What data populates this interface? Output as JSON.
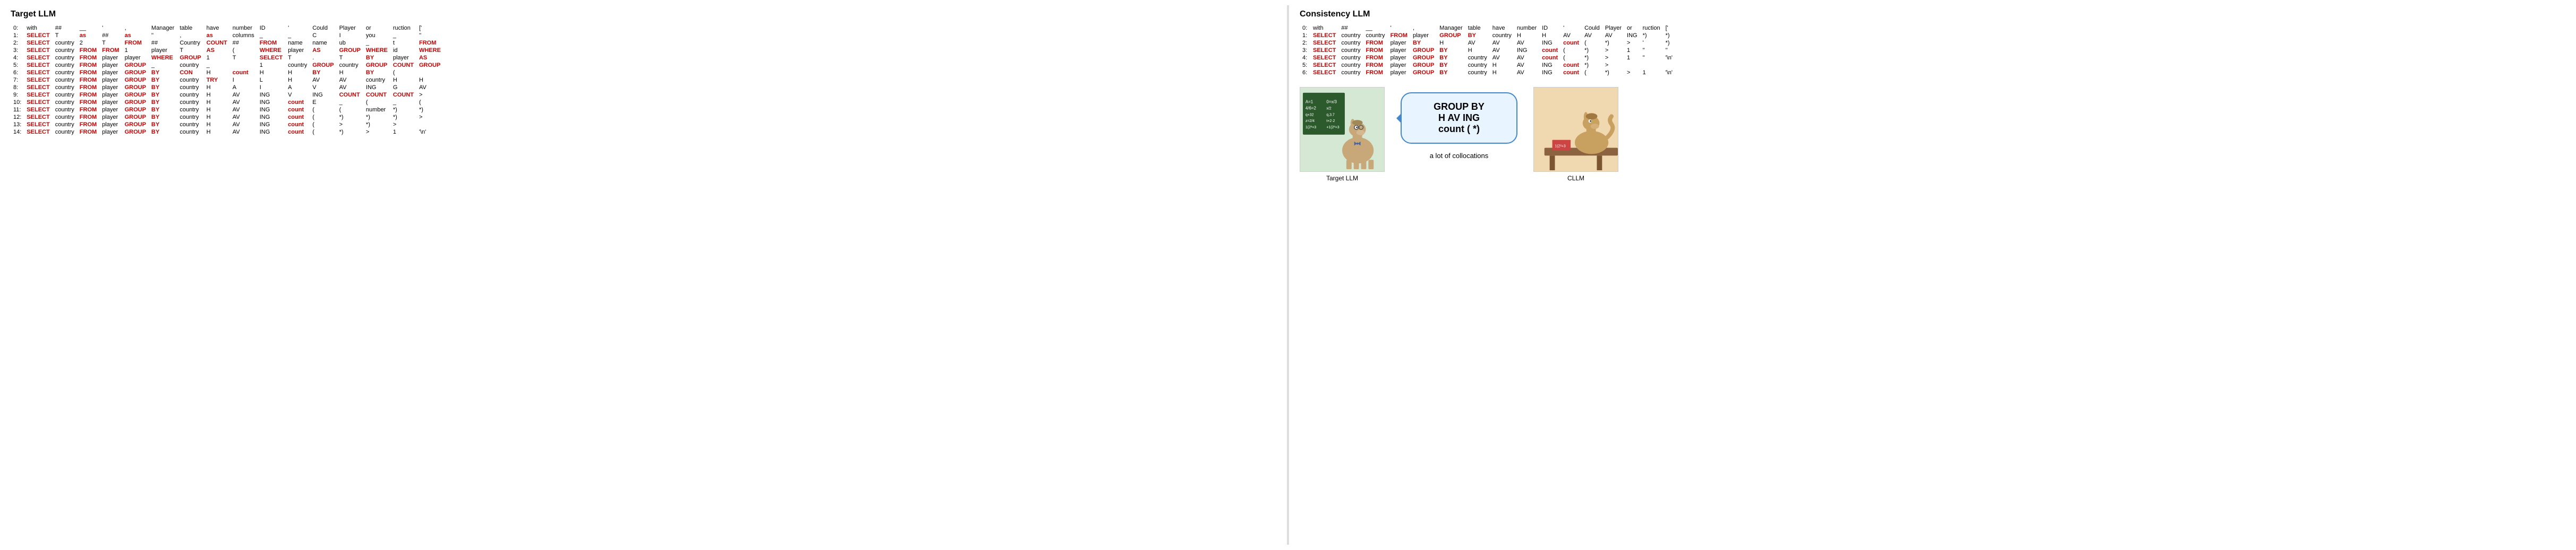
{
  "targetLLM": {
    "title": "Target LLM",
    "rows": [
      {
        "num": "0:",
        "tokens": [
          "with",
          "##",
          "__",
          "'",
          ",",
          "Manager",
          "table",
          "have",
          "number",
          "ID",
          "'",
          "Could",
          "Player",
          "or",
          "ruction",
          "['"
        ]
      },
      {
        "num": "1:",
        "tokens": [
          "SELECT",
          "T",
          "as",
          "##",
          "as",
          "''",
          ",",
          "as",
          "columns",
          "_",
          "_",
          "C",
          "I",
          "you",
          "_",
          "''"
        ],
        "highlight": false,
        "selectRow": true
      },
      {
        "num": "2:",
        "tokens": [
          "SELECT",
          "country",
          "2",
          "T",
          "FROM",
          "##",
          "Country",
          "COUNT",
          "##",
          "FROM",
          "name",
          "name",
          "ub",
          "_",
          "t",
          "FROM"
        ],
        "selectRow": true
      },
      {
        "num": "3:",
        "tokens": [
          "SELECT",
          "country",
          "FROM",
          "FROM",
          "1",
          "player",
          "T",
          "AS",
          "(",
          "WHERE",
          "player",
          "AS",
          "GROUP",
          "WHERE",
          "id",
          "WHERE"
        ],
        "selectRow": true
      },
      {
        "num": "4:",
        "tokens": [
          "SELECT",
          "country",
          "FROM",
          "player",
          "player",
          "WHERE",
          "GROUP",
          "1",
          "T",
          "SELECT",
          "T",
          ".",
          "T",
          "BY",
          "player",
          "AS"
        ],
        "selectRow": true
      },
      {
        "num": "5:",
        "tokens": [
          "SELECT",
          "country",
          "FROM",
          "player",
          "GROUP",
          "_",
          "country",
          "_",
          "",
          "1",
          "country",
          "GROUP",
          "country",
          "GROUP",
          "COUNT",
          "GROUP"
        ],
        "selectRow": true
      },
      {
        "num": "6:",
        "tokens": [
          "SELECT",
          "country",
          "FROM",
          "player",
          "GROUP",
          "BY",
          "CON",
          "H",
          "count",
          "H",
          "H",
          "BY",
          "H",
          "BY",
          "("
        ],
        "selectRow": true
      },
      {
        "num": "7:",
        "tokens": [
          "SELECT",
          "country",
          "FROM",
          "player",
          "GROUP",
          "BY",
          "country",
          "TRY",
          "I",
          "L",
          "H",
          "AV",
          "AV",
          "country",
          "H",
          "H"
        ],
        "selectRow": true
      },
      {
        "num": "8:",
        "tokens": [
          "SELECT",
          "country",
          "FROM",
          "player",
          "GROUP",
          "BY",
          "country",
          "H",
          "A",
          "I",
          "A",
          "V",
          "AV",
          "ING",
          "G",
          "AV"
        ],
        "selectRow": true
      },
      {
        "num": "9:",
        "tokens": [
          "SELECT",
          "country",
          "FROM",
          "player",
          "GROUP",
          "BY",
          "country",
          "H",
          "AV",
          "ING",
          "V",
          "ING",
          "COUNT",
          "COUNT",
          "COUNT",
          ">"
        ],
        "selectRow": true
      },
      {
        "num": "10:",
        "tokens": [
          "SELECT",
          "country",
          "FROM",
          "player",
          "GROUP",
          "BY",
          "country",
          "H",
          "AV",
          "ING",
          "count",
          "E",
          "_",
          "(",
          "_",
          "("
        ],
        "selectRow": true
      },
      {
        "num": "11:",
        "tokens": [
          "SELECT",
          "country",
          "FROM",
          "player",
          "GROUP",
          "BY",
          "country",
          "H",
          "AV",
          "ING",
          "count",
          "(",
          "(",
          "number",
          "*)",
          "*)"
        ],
        "selectRow": true
      },
      {
        "num": "12:",
        "tokens": [
          "SELECT",
          "country",
          "FROM",
          "player",
          "GROUP",
          "BY",
          "country",
          "H",
          "AV",
          "ING",
          "count",
          "(",
          "*)",
          "*)",
          "*)",
          ">"
        ],
        "selectRow": true
      },
      {
        "num": "13:",
        "tokens": [
          "SELECT",
          "country",
          "FROM",
          "player",
          "GROUP",
          "BY",
          "country",
          "H",
          "AV",
          "ING",
          "count",
          "(",
          ">",
          "*)",
          ">",
          ""
        ],
        "selectRow": true
      },
      {
        "num": "14:",
        "tokens": [
          "SELECT",
          "country",
          "FROM",
          "player",
          "GROUP",
          "BY",
          "country",
          "H",
          "AV",
          "ING",
          "count",
          "(",
          "*)",
          ">",
          "1",
          "'\\n'"
        ],
        "selectRow": true
      }
    ]
  },
  "consistencyLLM": {
    "title": "Consistency LLM",
    "rows": [
      {
        "num": "0:",
        "tokens": [
          "with",
          "##",
          "__",
          "'",
          ",",
          "Manager",
          "table",
          "have",
          "number",
          "ID",
          "'",
          "Could",
          "Player",
          "or",
          "ruction",
          "['"
        ]
      },
      {
        "num": "1:",
        "tokens": [
          "SELECT",
          "country",
          "country",
          "FROM",
          "player",
          "GROUP",
          "BY",
          "country",
          "H",
          "H",
          "AV",
          "AV",
          "AV",
          "ING",
          "*)",
          "*)"
        ],
        "selectRow": true
      },
      {
        "num": "2:",
        "tokens": [
          "SELECT",
          "country",
          "FROM",
          "player",
          "BY",
          "H",
          "AV",
          "AV",
          "AV",
          "ING",
          "count",
          "(",
          "*)",
          ">",
          "'",
          "*)"
        ],
        "selectRow": true
      },
      {
        "num": "3:",
        "tokens": [
          "SELECT",
          "country",
          "FROM",
          "player",
          "GROUP",
          "BY",
          "H",
          "AV",
          "ING",
          "count",
          "(",
          "*)",
          ">",
          "1",
          "''",
          "''"
        ],
        "selectRow": true
      },
      {
        "num": "4:",
        "tokens": [
          "SELECT",
          "country",
          "FROM",
          "player",
          "GROUP",
          "BY",
          "country",
          "AV",
          "AV",
          "count",
          "(",
          "*)",
          ">",
          "1",
          "''",
          "'\\n'"
        ],
        "selectRow": true
      },
      {
        "num": "5:",
        "tokens": [
          "SELECT",
          "country",
          "FROM",
          "player",
          "GROUP",
          "BY",
          "country",
          "H",
          "AV",
          "ING",
          "count",
          "*)",
          ">",
          "",
          "",
          ""
        ],
        "selectRow": true
      },
      {
        "num": "6:",
        "tokens": [
          "SELECT",
          "country",
          "FROM",
          "player",
          "GROUP",
          "BY",
          "country",
          "H",
          "AV",
          "ING",
          "count",
          "(",
          "*)",
          ">",
          "1",
          "'\\n'"
        ],
        "selectRow": true
      }
    ]
  },
  "speechBubble": {
    "line1": "GROUP BY",
    "line2": "H AV ING",
    "line3": "count ( *)"
  },
  "captions": {
    "targetLLM": "Target LLM",
    "cllm": "CLLM",
    "collocations": "a lot of collocations"
  }
}
